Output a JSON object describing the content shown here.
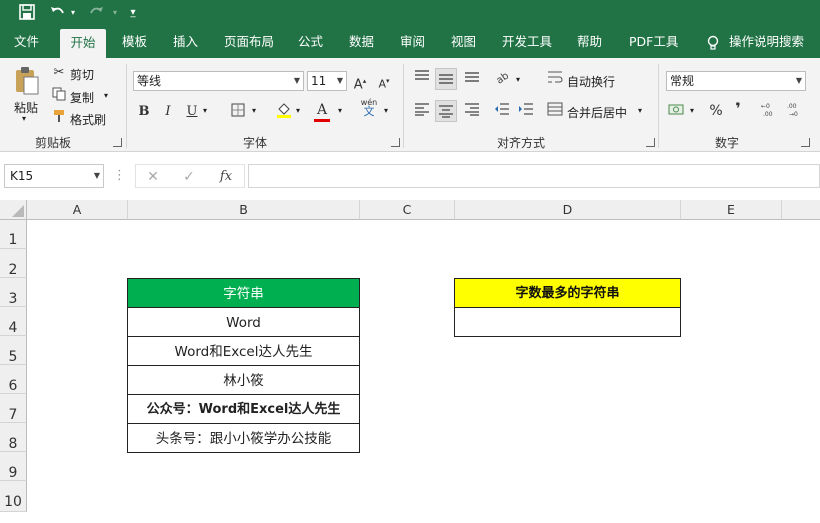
{
  "colors": {
    "excel_green": "#217346",
    "header_green": "#00b050",
    "highlight_yellow": "#ffff00"
  },
  "quick_access": {
    "save_icon": "save-icon",
    "undo_icon": "undo-icon",
    "redo_icon": "redo-icon",
    "customize_icon": "customize-icon"
  },
  "tabs": [
    "文件",
    "开始",
    "模板",
    "插入",
    "页面布局",
    "公式",
    "数据",
    "审阅",
    "视图",
    "开发工具",
    "帮助",
    "PDF工具"
  ],
  "active_tab": "开始",
  "search_label": "操作说明搜索",
  "clipboard": {
    "paste": "粘贴",
    "cut": "剪切",
    "copy": "复制",
    "format_painter": "格式刷",
    "group": "剪贴板"
  },
  "font": {
    "name": "等线",
    "size": "11",
    "bold": "B",
    "italic": "I",
    "underline": "U",
    "font_color_letter": "A",
    "wen": "wén",
    "wen_char": "文",
    "group": "字体"
  },
  "alignment": {
    "wrap": "自动换行",
    "merge": "合并后居中",
    "group": "对齐方式"
  },
  "number": {
    "format": "常规",
    "percent": "%",
    "comma": "❜",
    "group": "数字"
  },
  "formula_bar": {
    "name_box": "K15",
    "fx": "fx",
    "value": ""
  },
  "columns": [
    "A",
    "B",
    "C",
    "D",
    "E"
  ],
  "rows": [
    "1",
    "2",
    "3",
    "4",
    "5",
    "6",
    "7",
    "8",
    "9",
    "10"
  ],
  "table_b": {
    "header": "字符串",
    "items": [
      "Word",
      "Word和Excel达人先生",
      "林小筱",
      "公众号：Word和Excel达人先生",
      "头条号：跟小小筱学办公技能"
    ]
  },
  "table_d": {
    "header": "字数最多的字符串",
    "value": ""
  }
}
